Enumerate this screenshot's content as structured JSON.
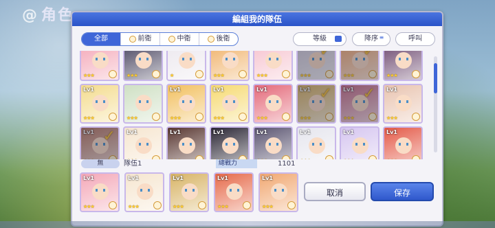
{
  "background": {
    "title": "角色"
  },
  "dialog": {
    "title": "編組我的隊伍"
  },
  "filter_tabs": [
    {
      "label": "全部",
      "active": true
    },
    {
      "label": "前衛",
      "active": false
    },
    {
      "label": "中衛",
      "active": false
    },
    {
      "label": "後衛",
      "active": false
    }
  ],
  "controls": {
    "level_label": "等級",
    "sort_label": "降序",
    "call_label": "呼叫"
  },
  "roster": [
    {
      "row": 0,
      "col": 0,
      "level": "",
      "stars": 3,
      "color": "#f4a8b8",
      "selected": false
    },
    {
      "row": 0,
      "col": 1,
      "level": "",
      "stars": 3,
      "color": "#4a4660",
      "selected": false
    },
    {
      "row": 0,
      "col": 2,
      "level": "",
      "stars": 1,
      "color": "#ece8ee",
      "selected": false
    },
    {
      "row": 0,
      "col": 3,
      "level": "",
      "stars": 3,
      "color": "#f0b26a",
      "selected": false
    },
    {
      "row": 0,
      "col": 4,
      "level": "",
      "stars": 3,
      "color": "#f6c3cf",
      "selected": false
    },
    {
      "row": 0,
      "col": 5,
      "level": "",
      "stars": 3,
      "color": "#cfcad8",
      "selected": true
    },
    {
      "row": 0,
      "col": 6,
      "level": "",
      "stars": 3,
      "color": "#f1a872",
      "selected": true
    },
    {
      "row": 0,
      "col": 7,
      "level": "",
      "stars": 3,
      "color": "#6e4a70",
      "selected": false
    },
    {
      "row": 1,
      "col": 0,
      "level": "Lv1",
      "stars": 3,
      "color": "#f4dc8e",
      "selected": false
    },
    {
      "row": 1,
      "col": 1,
      "level": "",
      "stars": 3,
      "color": "#cfe0c4",
      "selected": false
    },
    {
      "row": 1,
      "col": 2,
      "level": "Lv1",
      "stars": 3,
      "color": "#f2c060",
      "selected": false
    },
    {
      "row": 1,
      "col": 3,
      "level": "Lv1",
      "stars": 3,
      "color": "#f6da72",
      "selected": false
    },
    {
      "row": 1,
      "col": 4,
      "level": "Lv1",
      "stars": 3,
      "color": "#e46a7a",
      "selected": false
    },
    {
      "row": 1,
      "col": 5,
      "level": "Lv1",
      "stars": 3,
      "color": "#d8b466",
      "selected": true
    },
    {
      "row": 1,
      "col": 6,
      "level": "Lv1",
      "stars": 3,
      "color": "#c8708a",
      "selected": true
    },
    {
      "row": 1,
      "col": 7,
      "level": "Lv1",
      "stars": 3,
      "color": "#e9c4b0",
      "selected": false
    },
    {
      "row": 2,
      "col": 0,
      "level": "Lv1",
      "stars": 3,
      "color": "#b87a66",
      "selected": true
    },
    {
      "row": 2,
      "col": 1,
      "level": "Lv1",
      "stars": 3,
      "color": "#f6e6d0",
      "selected": false
    },
    {
      "row": 2,
      "col": 2,
      "level": "Lv1",
      "stars": 3,
      "color": "#5a3832",
      "selected": false
    },
    {
      "row": 2,
      "col": 3,
      "level": "Lv1",
      "stars": 3,
      "color": "#2c2836",
      "selected": false
    },
    {
      "row": 2,
      "col": 4,
      "level": "Lv1",
      "stars": 3,
      "color": "#5c5672",
      "selected": false
    },
    {
      "row": 2,
      "col": 5,
      "level": "Lv1",
      "stars": 3,
      "color": "#e6e6ee",
      "selected": false
    },
    {
      "row": 2,
      "col": 6,
      "level": "Lv1",
      "stars": 3,
      "color": "#d6c6f0",
      "selected": false
    },
    {
      "row": 2,
      "col": 7,
      "level": "Lv1",
      "stars": 3,
      "color": "#e45a48",
      "selected": false
    }
  ],
  "team_bar": {
    "tag": "無",
    "name": "隊伍1",
    "power_label": "總戰力",
    "power_value": "1101"
  },
  "team": [
    {
      "level": "Lv1",
      "stars": 3,
      "color": "#f4a8b8"
    },
    {
      "level": "Lv1",
      "stars": 3,
      "color": "#f6e6d0"
    },
    {
      "level": "Lv1",
      "stars": 3,
      "color": "#d8b466"
    },
    {
      "level": "Lv1",
      "stars": 3,
      "color": "#e66a4a"
    },
    {
      "level": "Lv1",
      "stars": 3,
      "color": "#f1a872"
    }
  ],
  "buttons": {
    "cancel": "取消",
    "save": "保存"
  },
  "colors": {
    "accent": "#3f66d8",
    "star": "#ffcc2e",
    "check": "#f4c03a"
  }
}
